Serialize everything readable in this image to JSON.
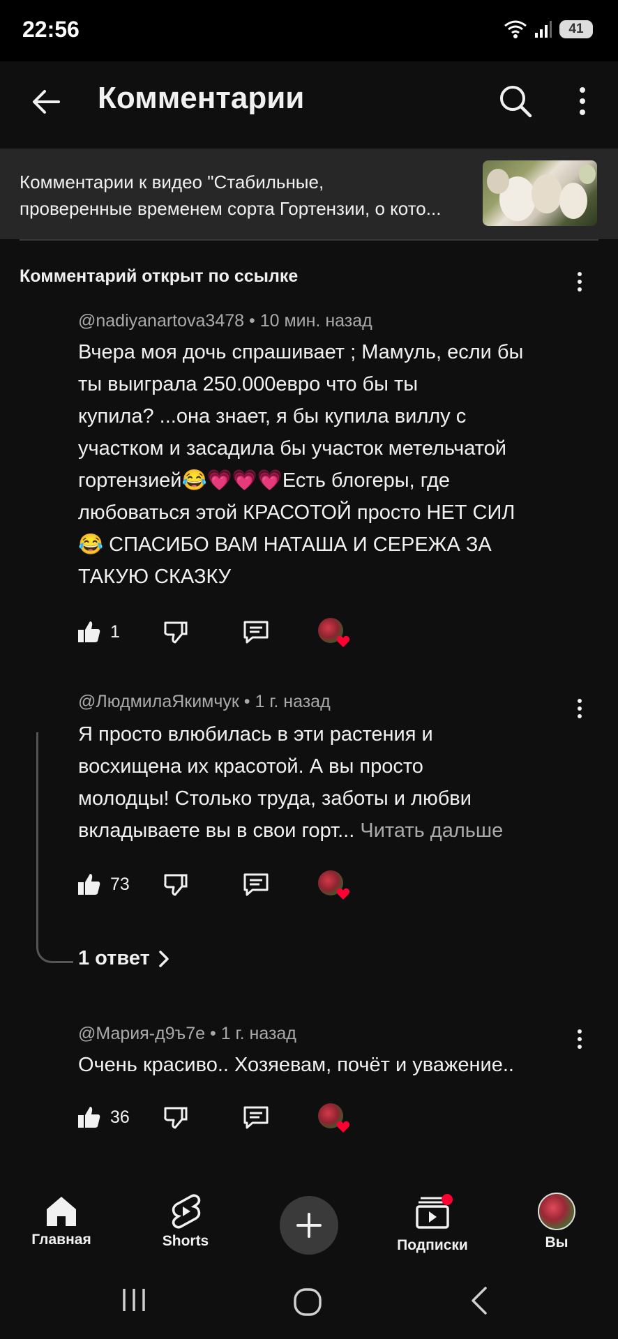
{
  "status": {
    "time": "22:56",
    "battery": "41"
  },
  "header": {
    "title": "Комментарии",
    "back_icon": "arrow-left-icon",
    "search_icon": "search-icon",
    "menu_icon": "more-vert-icon"
  },
  "context": {
    "line1": "Комментарии к видео \"Стабильные,",
    "line2": "проверенные временем сорта Гортензии, о кото..."
  },
  "pinned_label": "Комментарий открыт по ссылке",
  "comments": [
    {
      "author": "@nadiyanartova3478",
      "time": "10 мин. назад",
      "lines": [
        "Вчера моя дочь спрашивает ; Мамуль, если бы",
        "ты выиграла 250.000евро что бы ты",
        "купила? ...она знает, я бы купила виллу с",
        "участком и засадила бы участок метельчатой",
        "гортензией😂💗💗💗Есть блогеры, где",
        "любоваться этой КРАСОТОЙ просто НЕТ СИЛ",
        "😂 СПАСИБО ВАМ НАТАША И СЕРЕЖА ЗА",
        "ТАКУЮ СКАЗКУ"
      ],
      "likes": "1"
    },
    {
      "author": "@ЛюдмилаЯкимчук",
      "time": "1 г. назад",
      "lines": [
        "Я просто влюбилась в эти растения  и",
        "восхищена их красотой. А вы просто",
        "молодцы!  Столько труда, заботы и любви",
        "вкладываете вы в свои горт..."
      ],
      "read_more": "Читать дальше",
      "likes": "73",
      "replies": "1 ответ"
    },
    {
      "author": "@Мария-д9ъ7е",
      "time": "1 г. назад",
      "lines": [
        "Очень красиво.. Хозяевам, почёт и уважение.."
      ],
      "likes": "36"
    }
  ],
  "nav": {
    "home": "Главная",
    "shorts": "Shorts",
    "subscriptions": "Подписки",
    "you": "Вы"
  }
}
